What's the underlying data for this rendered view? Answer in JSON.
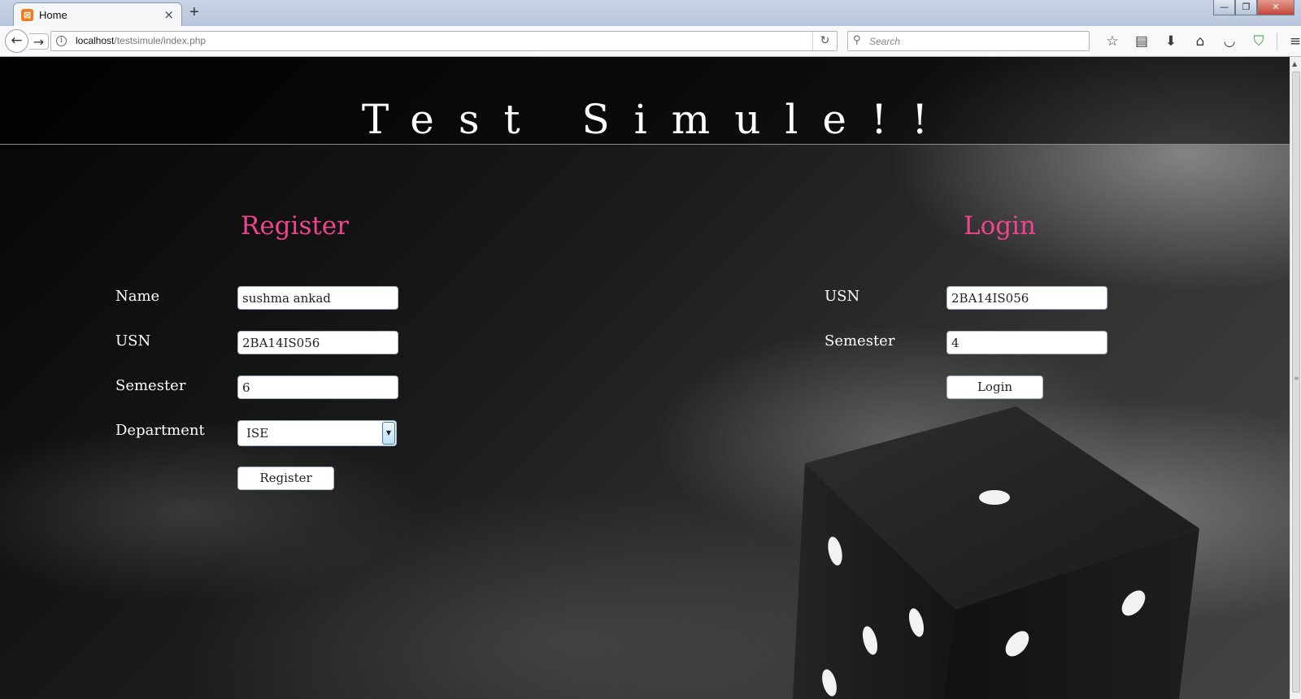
{
  "browser": {
    "tab_title": "Home",
    "tab_close": "×",
    "new_tab": "+",
    "url_host": "localhost",
    "url_path": "/testsimule/index.php",
    "search_placeholder": "Search",
    "window_controls": {
      "minimize": "—",
      "restore": "❐",
      "close": "✕"
    },
    "toolbar_icons": [
      "star-icon",
      "reading-list-icon",
      "download-icon",
      "home-icon",
      "pocket-icon",
      "shield-icon",
      "menu-icon"
    ]
  },
  "page": {
    "title": "Test Simule!!",
    "register": {
      "heading": "Register",
      "name_label": "Name",
      "name_value": "sushma ankad",
      "usn_label": "USN",
      "usn_value": "2BA14IS056",
      "semester_label": "Semester",
      "semester_value": "6",
      "department_label": "Department",
      "department_value": "ISE",
      "submit_label": "Register"
    },
    "login": {
      "heading": "Login",
      "usn_label": "USN",
      "usn_value": "2BA14IS056",
      "semester_label": "Semester",
      "semester_value": "4",
      "submit_label": "Login"
    }
  },
  "colors": {
    "heading_pink": "#f0448f",
    "page_text": "#ffffff"
  }
}
